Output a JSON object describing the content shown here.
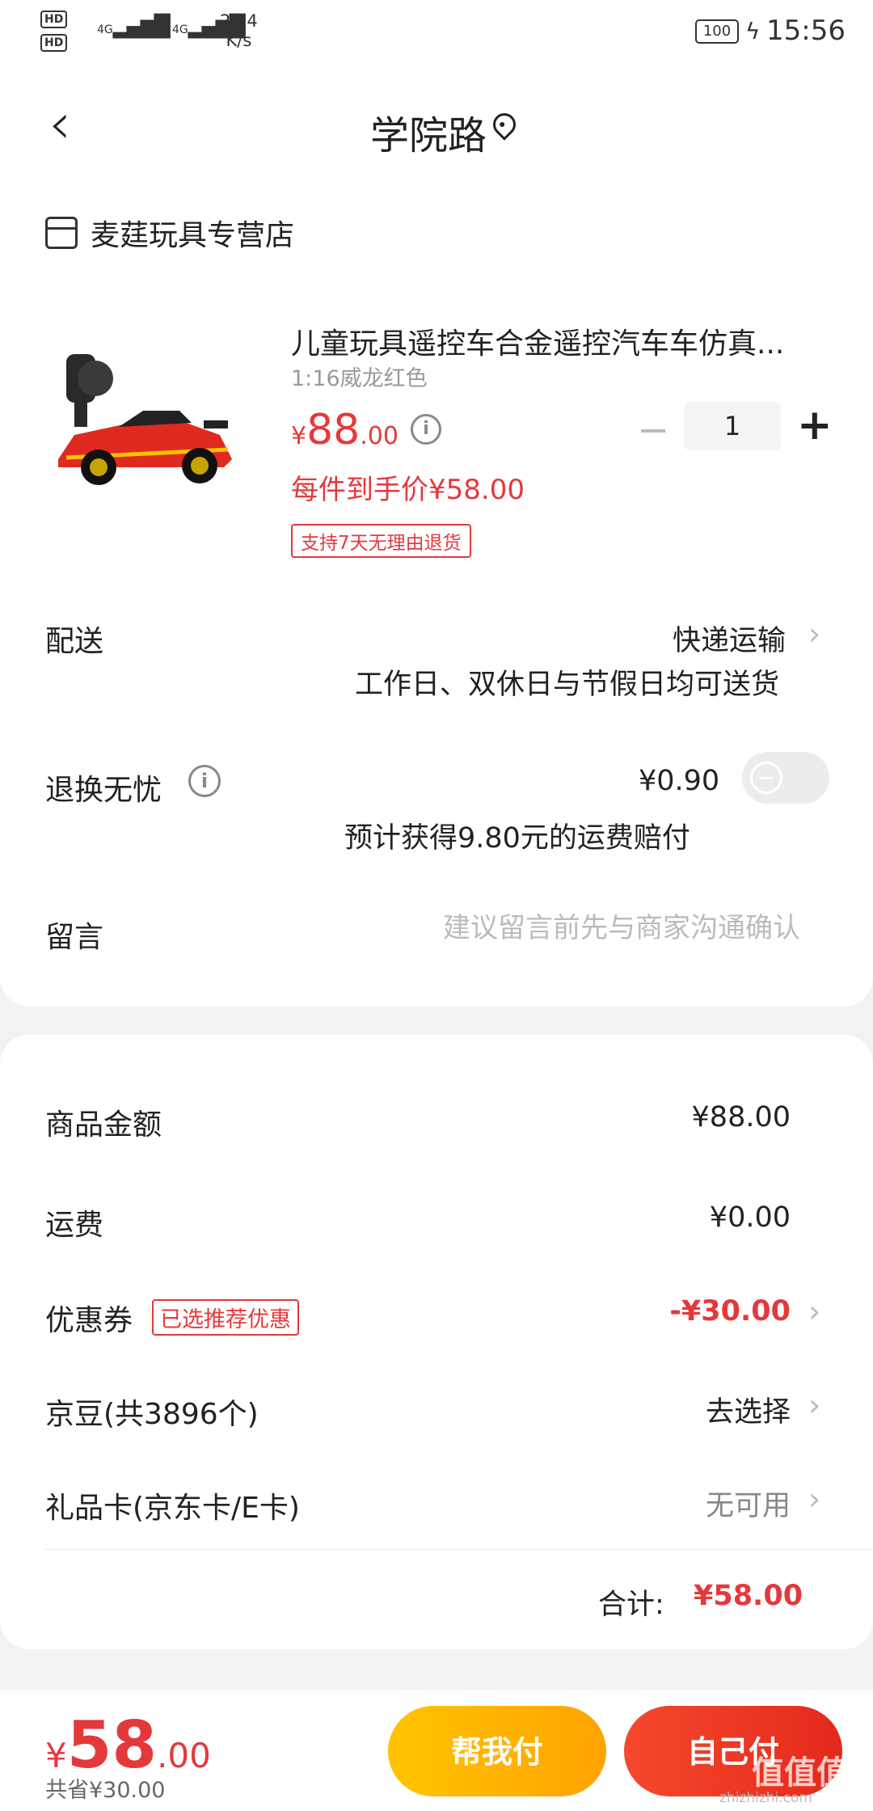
{
  "status_bar": {
    "sim1": "HD",
    "sim2": "HD",
    "signal": "4G",
    "net_speed": "24.4",
    "net_unit": "K/s",
    "battery": "100",
    "time": "15:56"
  },
  "header": {
    "back_icon": "back-arrow-icon",
    "title": "学院路",
    "location_icon": "location-pin-icon"
  },
  "shop": {
    "icon": "shop-icon",
    "name": "麦莛玩具专营店"
  },
  "product": {
    "title": "儿童玩具遥控车合金遥控汽车车仿真...",
    "spec": "1:16威龙红色",
    "currency": "¥",
    "price_int": "88",
    "price_dec": ".00",
    "deal_price": "每件到手价¥58.00",
    "return_badge": "支持7天无理由退货",
    "quantity": "1",
    "minus": "−",
    "plus": "+"
  },
  "delivery": {
    "label": "配送",
    "value": "快递运输",
    "sub": "工作日、双休日与节假日均可送货"
  },
  "worry_free": {
    "label": "退换无忧",
    "price": "¥0.90",
    "sub": "预计获得9.80元的运费赔付",
    "enabled": false
  },
  "message": {
    "label": "留言",
    "placeholder": "建议留言前先与商家沟通确认"
  },
  "summary": {
    "goods_label": "商品金额",
    "goods_value": "¥88.00",
    "shipping_label": "运费",
    "shipping_value": "¥0.00",
    "coupon_label": "优惠券",
    "coupon_badge": "已选推荐优惠",
    "coupon_value": "-¥30.00",
    "beans_label": "京豆(共3896个)",
    "beans_value": "去选择",
    "giftcard_label": "礼品卡(京东卡/E卡)",
    "giftcard_value": "无可用",
    "total_label": "合计:",
    "total_value": "¥58.00"
  },
  "bottom_bar": {
    "currency": "¥",
    "price_int": "58",
    "price_dec": ".00",
    "saved": "共省¥30.00",
    "help_pay": "帮我付",
    "self_pay": "自己付"
  },
  "watermark": {
    "logo": "值值值",
    "site": "zhizhizhi.com"
  },
  "colors": {
    "accent": "#e4393c",
    "help_button": "#ffb300",
    "self_button": "#ee3823"
  }
}
